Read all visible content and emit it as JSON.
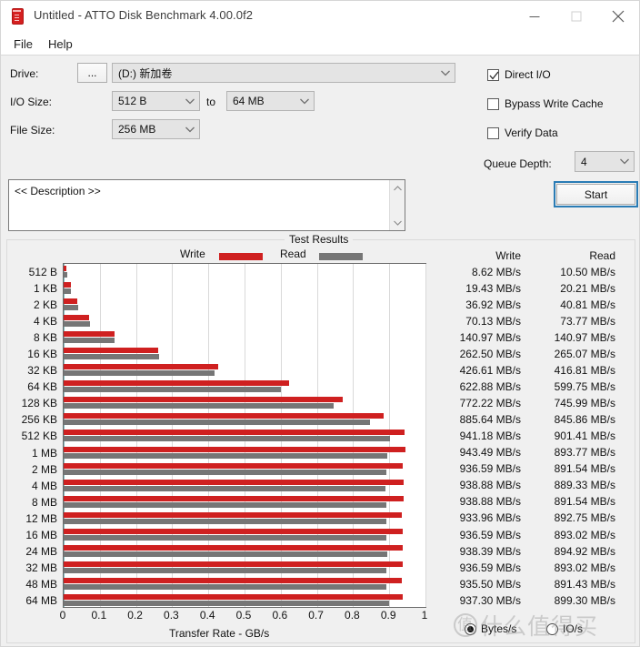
{
  "window": {
    "title": "Untitled - ATTO Disk Benchmark 4.00.0f2",
    "icon": "atto-logo-icon",
    "minimize": "minimize-icon",
    "maximize": "maximize-icon",
    "close": "close-icon"
  },
  "menu": {
    "items": [
      {
        "label": "File"
      },
      {
        "label": "Help"
      }
    ]
  },
  "options": {
    "drive_label": "Drive:",
    "browse_label": "...",
    "drive_value": "(D:) 新加卷",
    "io_size_label": "I/O Size:",
    "io_size_from": "512 B",
    "io_size_to_label": "to",
    "io_size_to": "64 MB",
    "file_size_label": "File Size:",
    "file_size_value": "256 MB",
    "direct_io_label": "Direct I/O",
    "direct_io_checked": true,
    "bypass_cache_label": "Bypass Write Cache",
    "bypass_cache_checked": false,
    "verify_data_label": "Verify Data",
    "verify_data_checked": false,
    "queue_depth_label": "Queue Depth:",
    "queue_depth_value": "4"
  },
  "description": {
    "text": "<< Description >>"
  },
  "start_button": {
    "label": "Start"
  },
  "results": {
    "group_title": "Test Results",
    "legend_write": "Write",
    "legend_read": "Read",
    "col_write": "Write",
    "col_read": "Read",
    "unit_bytes_label": "Bytes/s",
    "unit_io_label": "IO/s",
    "unit_selected": "Bytes/s",
    "watermark": "什么值得买"
  },
  "chart_data": {
    "type": "bar",
    "title": "Test Results",
    "xlabel": "Transfer Rate - GB/s",
    "ylabel": "",
    "orientation": "horizontal",
    "xlim": [
      0,
      1
    ],
    "xticks": [
      "0",
      "0.1",
      "0.2",
      "0.3",
      "0.4",
      "0.5",
      "0.6",
      "0.7",
      "0.8",
      "0.9",
      "1"
    ],
    "grid": true,
    "legend_position": "top",
    "categories": [
      "512 B",
      "1 KB",
      "2 KB",
      "4 KB",
      "8 KB",
      "16 KB",
      "32 KB",
      "64 KB",
      "128 KB",
      "256 KB",
      "512 KB",
      "1 MB",
      "2 MB",
      "4 MB",
      "8 MB",
      "12 MB",
      "16 MB",
      "24 MB",
      "32 MB",
      "48 MB",
      "64 MB"
    ],
    "series": [
      {
        "name": "Write",
        "color": "#cf2020",
        "unit": "MB/s",
        "values": [
          8.62,
          19.43,
          36.92,
          70.13,
          140.97,
          262.5,
          426.61,
          622.88,
          772.22,
          885.64,
          941.18,
          943.49,
          936.59,
          938.88,
          938.88,
          933.96,
          936.59,
          938.39,
          936.59,
          935.5,
          937.3
        ],
        "labels": [
          "8.62 MB/s",
          "19.43 MB/s",
          "36.92 MB/s",
          "70.13 MB/s",
          "140.97 MB/s",
          "262.50 MB/s",
          "426.61 MB/s",
          "622.88 MB/s",
          "772.22 MB/s",
          "885.64 MB/s",
          "941.18 MB/s",
          "943.49 MB/s",
          "936.59 MB/s",
          "938.88 MB/s",
          "938.88 MB/s",
          "933.96 MB/s",
          "936.59 MB/s",
          "938.39 MB/s",
          "936.59 MB/s",
          "935.50 MB/s",
          "937.30 MB/s"
        ]
      },
      {
        "name": "Read",
        "color": "#767676",
        "unit": "MB/s",
        "values": [
          10.5,
          20.21,
          40.81,
          73.77,
          140.97,
          265.07,
          416.81,
          599.75,
          745.99,
          845.86,
          901.41,
          893.77,
          891.54,
          889.33,
          891.54,
          892.75,
          893.02,
          894.92,
          893.02,
          891.43,
          899.3
        ],
        "labels": [
          "10.50 MB/s",
          "20.21 MB/s",
          "40.81 MB/s",
          "73.77 MB/s",
          "140.97 MB/s",
          "265.07 MB/s",
          "416.81 MB/s",
          "599.75 MB/s",
          "745.99 MB/s",
          "845.86 MB/s",
          "901.41 MB/s",
          "893.77 MB/s",
          "891.54 MB/s",
          "889.33 MB/s",
          "891.54 MB/s",
          "892.75 MB/s",
          "893.02 MB/s",
          "894.92 MB/s",
          "893.02 MB/s",
          "891.43 MB/s",
          "899.30 MB/s"
        ]
      }
    ]
  }
}
